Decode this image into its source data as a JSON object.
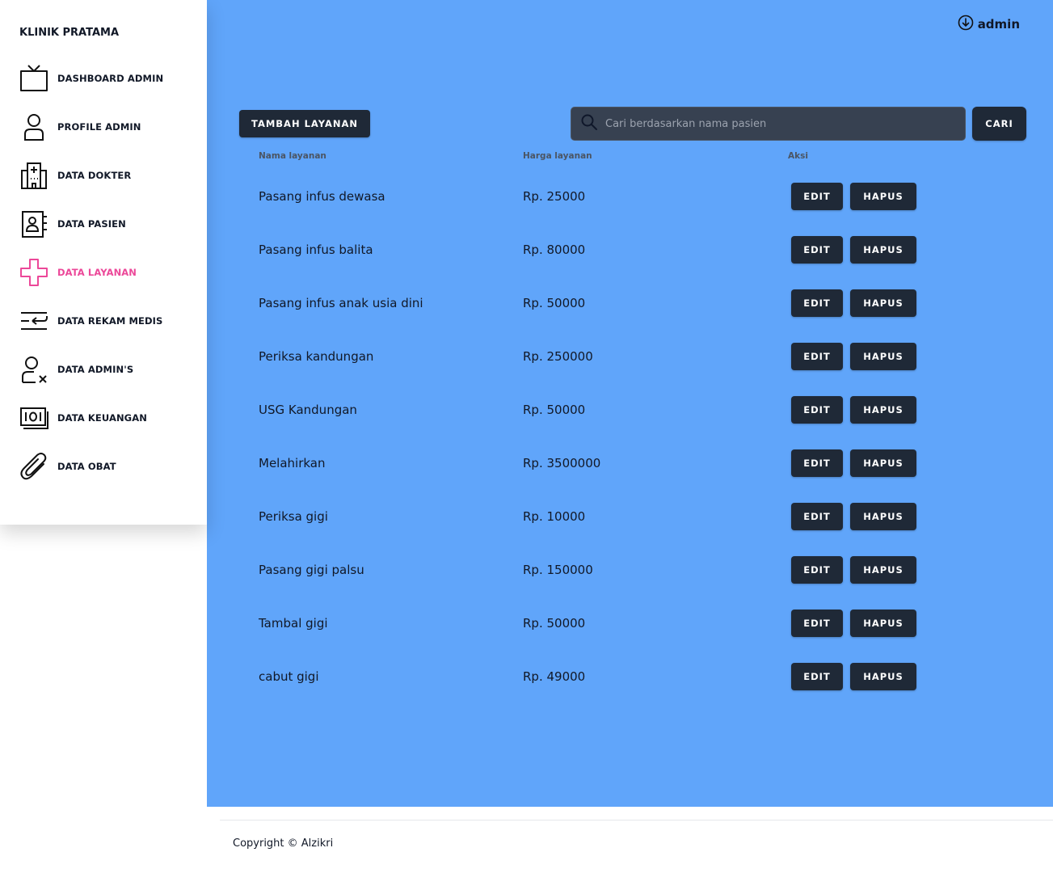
{
  "sidebar": {
    "brand": "KLINIK PRATAMA",
    "items": [
      {
        "label": "DASHBOARD ADMIN",
        "icon": "tv-icon"
      },
      {
        "label": "PROFILE ADMIN",
        "icon": "user-icon"
      },
      {
        "label": "DATA DOKTER",
        "icon": "hospital-icon"
      },
      {
        "label": "DATA PASIEN",
        "icon": "contact-book-icon"
      },
      {
        "label": "DATA LAYANAN",
        "icon": "medical-cross-icon",
        "active": true
      },
      {
        "label": "DATA REKAM MEDIS",
        "icon": "text-wrap-icon"
      },
      {
        "label": "DATA ADMIN'S",
        "icon": "user-remove-icon"
      },
      {
        "label": "DATA KEUANGAN",
        "icon": "money-icon"
      },
      {
        "label": "DATA OBAT",
        "icon": "paperclip-icon"
      }
    ],
    "active_color": "#ec4899"
  },
  "header": {
    "user": "admin"
  },
  "toolbar": {
    "add_label": "TAMBAH LAYANAN",
    "search_placeholder": "Cari berdasarkan nama pasien",
    "search_button": "CARI"
  },
  "table": {
    "headers": [
      "Nama layanan",
      "Harga layanan",
      "Aksi"
    ],
    "edit_label": "EDIT",
    "delete_label": "HAPUS",
    "rows": [
      {
        "name": "Pasang infus dewasa",
        "price": "Rp. 25000"
      },
      {
        "name": "Pasang infus balita",
        "price": "Rp. 80000"
      },
      {
        "name": "Pasang infus anak usia dini",
        "price": "Rp. 50000"
      },
      {
        "name": "Periksa kandungan",
        "price": "Rp. 250000"
      },
      {
        "name": "USG Kandungan",
        "price": "Rp. 50000"
      },
      {
        "name": "Melahirkan",
        "price": "Rp. 3500000"
      },
      {
        "name": "Periksa gigi",
        "price": "Rp. 10000"
      },
      {
        "name": "Pasang gigi palsu",
        "price": "Rp. 150000"
      },
      {
        "name": "Tambal gigi",
        "price": "Rp. 50000"
      },
      {
        "name": "cabut gigi",
        "price": "Rp. 49000"
      }
    ]
  },
  "footer": {
    "copyright": "Copyright © Alzikri"
  },
  "colors": {
    "main_bg": "#60a5fa",
    "button_bg": "#1f2937",
    "search_bg": "#374151"
  }
}
